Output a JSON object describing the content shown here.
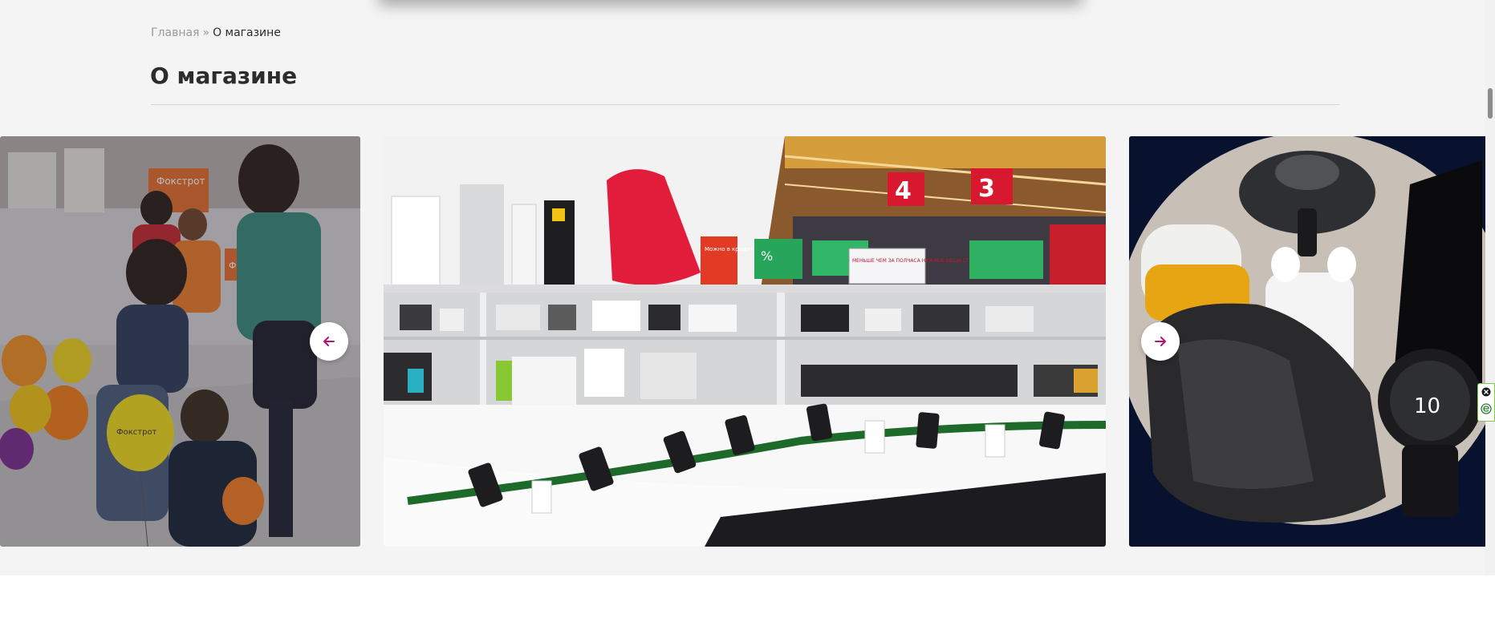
{
  "breadcrumb": {
    "home": "Главная",
    "separator": "»",
    "current": "О магазине"
  },
  "page": {
    "title": "О магазине"
  },
  "slider": {
    "slides": [
      {
        "name": "store-event-photo",
        "signs": [
          "Фокстрот",
          "Фокстрот",
          "Фокстрот"
        ]
      },
      {
        "name": "store-showcase-photo",
        "signs": [
          "4",
          "3",
          "Можно в кредит",
          "%",
          "МЕНЬШЕ ЧЕМ ЗА ПОЛЧАСА НУЖНЫЕ ВЕЩИ СТАНУТ ВАШИМИ"
        ]
      },
      {
        "name": "gadgets-collage-photo",
        "signs": [
          "10"
        ]
      }
    ],
    "prev_icon": "arrow-left-icon",
    "next_icon": "arrow-right-icon"
  },
  "colors": {
    "accent": "#b0157a",
    "background": "#f4f4f4",
    "title": "#2c2c2c",
    "breadcrumb_muted": "#9a9a9a"
  },
  "widget": {
    "close_icon": "close-circle-icon",
    "e_icon": "e-letter-icon"
  }
}
